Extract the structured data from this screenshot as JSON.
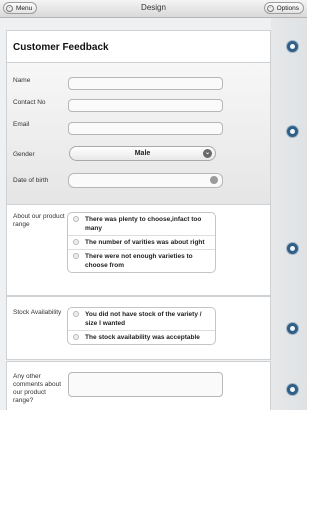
{
  "topbar": {
    "title": "Design",
    "menu_label": "Menu",
    "options_label": "Options"
  },
  "form": {
    "title": "Customer Feedback",
    "fields": {
      "name_label": "Name",
      "contact_label": "Contact No",
      "email_label": "Email",
      "gender_label": "Gender",
      "gender_value": "Male",
      "dob_label": "Date of birth"
    },
    "product_range": {
      "label": "About our product range",
      "options": [
        "There was plenty to choose,infact too many",
        "The number of varities was about right",
        "There were not enough varieties to choose from"
      ]
    },
    "stock": {
      "label": "Stock Availability",
      "options": [
        "You did not have stock of the variety / size I wanted",
        "The stock availability was acceptable"
      ]
    },
    "comments": {
      "label": "Any other comments about our product range?"
    }
  },
  "icons": {
    "chevron": "chevron-right-icon",
    "dropdown": "chevron-down-icon",
    "calendar": "calendar-icon"
  },
  "colors": {
    "accent": "#2f5f86",
    "background": "#eef0f1"
  }
}
